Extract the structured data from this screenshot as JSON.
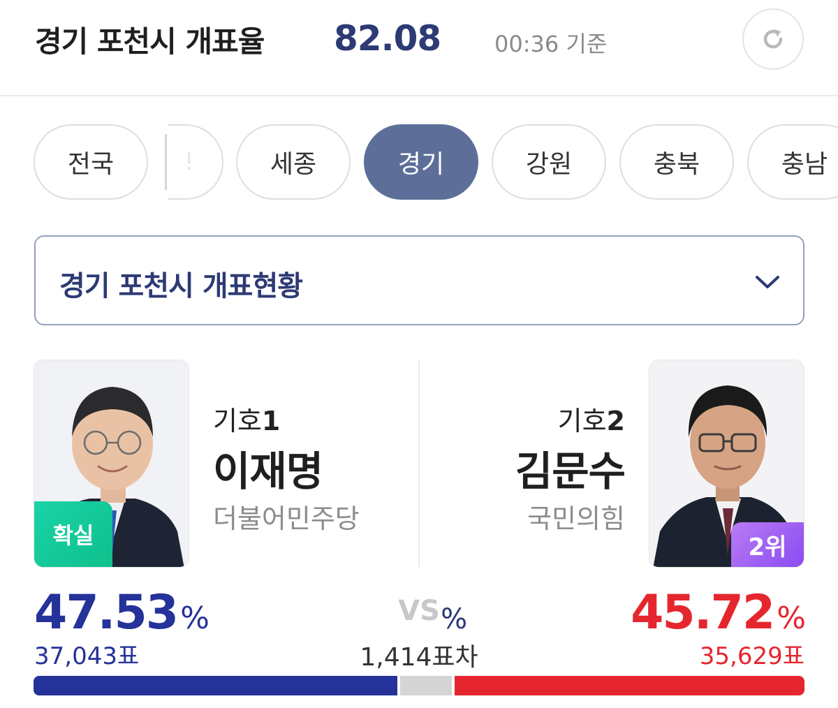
{
  "header": {
    "title": "경기 포천시 개표율",
    "rate": "82.08",
    "rate_unit": "%",
    "time": "00:36 기준",
    "refresh_icon": "refresh-icon"
  },
  "tabs": [
    {
      "label": "전국",
      "active": false
    },
    {
      "label": "세종",
      "active": false
    },
    {
      "label": "경기",
      "active": true
    },
    {
      "label": "강원",
      "active": false
    },
    {
      "label": "충북",
      "active": false
    },
    {
      "label": "충남",
      "active": false
    }
  ],
  "dropdown": {
    "label": "경기 포천시 개표현황",
    "icon": "chevron-down-icon"
  },
  "candidates": {
    "left": {
      "number_label": "기호",
      "number": "1",
      "name": "이재명",
      "party": "더불어민주당",
      "badge": "확실",
      "percent": "47.53",
      "percent_unit": "%",
      "votes": "37,043표",
      "color": "#24329a"
    },
    "right": {
      "number_label": "기호",
      "number": "2",
      "name": "김문수",
      "party": "국민의힘",
      "badge": "2위",
      "percent": "45.72",
      "percent_unit": "%",
      "votes": "35,629표",
      "color": "#e5262e"
    }
  },
  "versus": {
    "label": "VS",
    "margin": "1,414표차"
  },
  "vote_bar": {
    "left_share": 47.53,
    "other_share": 6.75,
    "right_share": 45.72
  }
}
